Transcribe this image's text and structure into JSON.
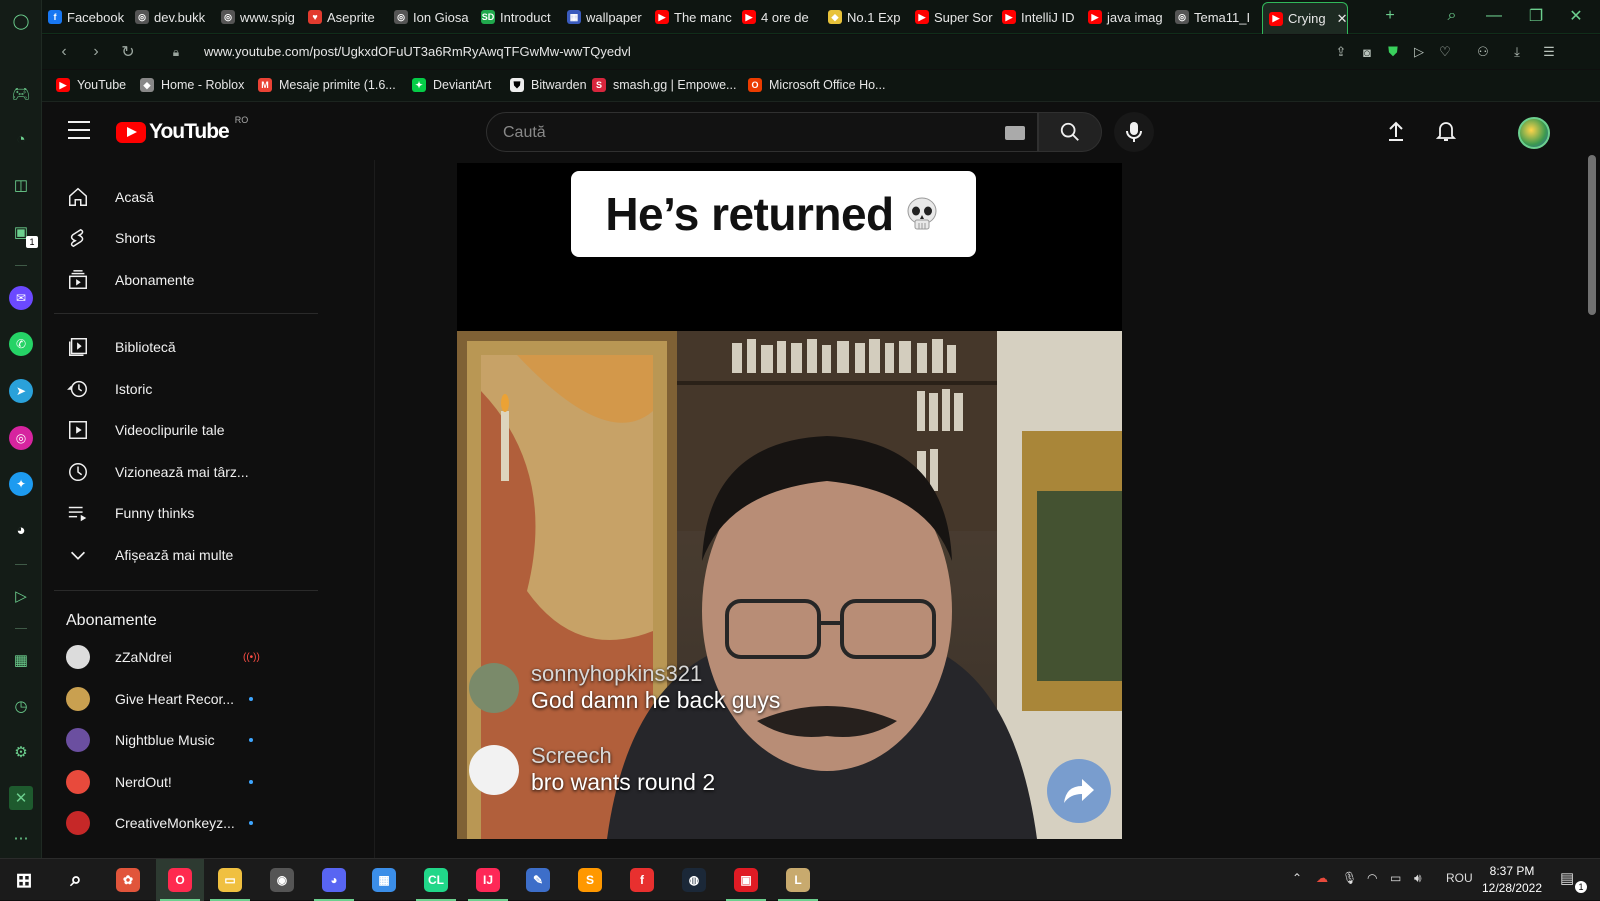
{
  "browser": {
    "tabs": [
      {
        "label": "Facebook",
        "color": "#1877f2",
        "glyph": "f"
      },
      {
        "label": "dev.bukk",
        "color": "#555555",
        "glyph": "◎"
      },
      {
        "label": "www.spig",
        "color": "#555555",
        "glyph": "◎"
      },
      {
        "label": "Aseprite",
        "color": "#e23b2e",
        "glyph": "♥"
      },
      {
        "label": "Ion Giosa",
        "color": "#555555",
        "glyph": "◎"
      },
      {
        "label": "Introduct",
        "color": "#20a84c",
        "glyph": "SD"
      },
      {
        "label": "wallpaper",
        "color": "#3a5bbd",
        "glyph": "▦"
      },
      {
        "label": "The manc",
        "color": "#ff0000",
        "glyph": "▶"
      },
      {
        "label": "4 ore de",
        "color": "#ff0000",
        "glyph": "▶"
      },
      {
        "label": "No.1 Exp",
        "color": "#e8c23a",
        "glyph": "◆"
      },
      {
        "label": "Super Sor",
        "color": "#ff0000",
        "glyph": "▶"
      },
      {
        "label": "IntelliJ ID",
        "color": "#ff0000",
        "glyph": "▶"
      },
      {
        "label": "java imag",
        "color": "#ff0000",
        "glyph": "▶"
      },
      {
        "label": "Tema11_I",
        "color": "#555555",
        "glyph": "◎"
      },
      {
        "label": "Crying",
        "color": "#ff0000",
        "glyph": "▶"
      }
    ],
    "url": "www.youtube.com/post/UgkxdOFuUT3a6RmRyAwqTFGwMw-wwTQyedvl",
    "bookmarks": [
      {
        "label": "YouTube",
        "color": "#ff0000",
        "glyph": "▶"
      },
      {
        "label": "Home - Roblox",
        "color": "#888888",
        "glyph": "◆"
      },
      {
        "label": "Mesaje primite (1.6...",
        "color": "#ea4335",
        "glyph": "M"
      },
      {
        "label": "DeviantArt",
        "color": "#05cc47",
        "glyph": "✦"
      },
      {
        "label": "Bitwarden",
        "color": "#eeeeee",
        "glyph": "⛊"
      },
      {
        "label": "smash.gg | Empowe...",
        "color": "#d7263d",
        "glyph": "S"
      },
      {
        "label": "Microsoft Office Ho...",
        "color": "#eb3c00",
        "glyph": "O"
      }
    ]
  },
  "youtube": {
    "logo_text": "YouTube",
    "country_code": "RO",
    "search_placeholder": "Caută",
    "nav": [
      {
        "label": "Acasă",
        "icon": "home-icon"
      },
      {
        "label": "Shorts",
        "icon": "shorts-icon"
      },
      {
        "label": "Abonamente",
        "icon": "subscriptions-icon"
      }
    ],
    "library": [
      {
        "label": "Bibliotecă",
        "icon": "library-icon"
      },
      {
        "label": "Istoric",
        "icon": "history-icon"
      },
      {
        "label": "Videoclipurile tale",
        "icon": "your-videos-icon"
      },
      {
        "label": "Vizionează mai târz...",
        "icon": "watch-later-icon"
      },
      {
        "label": "Funny thinks",
        "icon": "playlist-icon"
      },
      {
        "label": "Afișează mai multe",
        "icon": "chevron-down-icon"
      }
    ],
    "subscriptions_title": "Abonamente",
    "subscriptions": [
      {
        "label": "zZaNdrei",
        "status": "live",
        "avatar_color": "#dcdcdc"
      },
      {
        "label": "Give Heart Recor...",
        "status": "new",
        "avatar_color": "#c9a050"
      },
      {
        "label": "Nightblue Music",
        "status": "new",
        "avatar_color": "#6b4fa0"
      },
      {
        "label": "NerdOut!",
        "status": "new",
        "avatar_color": "#e84a3c"
      },
      {
        "label": "CreativeMonkeyz...",
        "status": "new",
        "avatar_color": "#c62828"
      }
    ],
    "post": {
      "caption": "He’s returned",
      "comments": [
        {
          "user": "sonnyhopkins321",
          "message": "God damn he back guys"
        },
        {
          "user": "Screech",
          "message": "bro wants round 2"
        }
      ]
    }
  },
  "taskbar": {
    "apps": [
      {
        "name": "windows-start",
        "color": "#ffffff",
        "glyph": "⊞"
      },
      {
        "name": "search",
        "color": "#ffffff",
        "glyph": "⌕"
      },
      {
        "name": "app-creative",
        "color": "#e1553b",
        "glyph": "✿"
      },
      {
        "name": "opera-gx",
        "color": "#ff2a4f",
        "glyph": "O"
      },
      {
        "name": "file-explorer",
        "color": "#f0c040",
        "glyph": "▭"
      },
      {
        "name": "obs",
        "color": "#555555",
        "glyph": "◉"
      },
      {
        "name": "discord",
        "color": "#5865f2",
        "glyph": "◕"
      },
      {
        "name": "ms-store",
        "color": "#3b8ee8",
        "glyph": "▦"
      },
      {
        "name": "clion",
        "color": "#21d789",
        "glyph": "CL"
      },
      {
        "name": "intellij",
        "color": "#fe2857",
        "glyph": "IJ"
      },
      {
        "name": "paint",
        "color": "#3d6ec9",
        "glyph": "✎"
      },
      {
        "name": "sublime",
        "color": "#ff9800",
        "glyph": "S"
      },
      {
        "name": "flash",
        "color": "#e8302f",
        "glyph": "f"
      },
      {
        "name": "steam",
        "color": "#1b2838",
        "glyph": "◍"
      },
      {
        "name": "app-red",
        "color": "#e01b24",
        "glyph": "▣"
      },
      {
        "name": "league",
        "color": "#c8aa6e",
        "glyph": "L"
      }
    ],
    "language": "ROU",
    "time": "8:37 PM",
    "date": "12/28/2022",
    "notification_count": "1"
  },
  "opera_sidebar_badge": "1"
}
